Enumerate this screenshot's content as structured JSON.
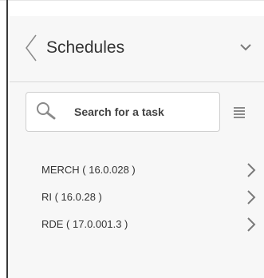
{
  "panel": {
    "title": "Schedules",
    "back_icon": "chevron-left-icon",
    "collapse_icon": "chevron-down-icon"
  },
  "search": {
    "label": "Search for a task",
    "icon": "search-icon",
    "list_icon": "list-icon"
  },
  "tasks": [
    {
      "label": "MERCH ( 16.0.028 )",
      "icon": "chevron-right-icon"
    },
    {
      "label": "RI ( 16.0.28 )",
      "icon": "chevron-right-icon"
    },
    {
      "label": "RDE ( 17.0.001.3 )",
      "icon": "chevron-right-icon"
    }
  ],
  "colors": {
    "panel_background": "#f7f7f7",
    "text": "#333333",
    "icon": "#7a7a7a",
    "border": "#cfcfcf"
  }
}
